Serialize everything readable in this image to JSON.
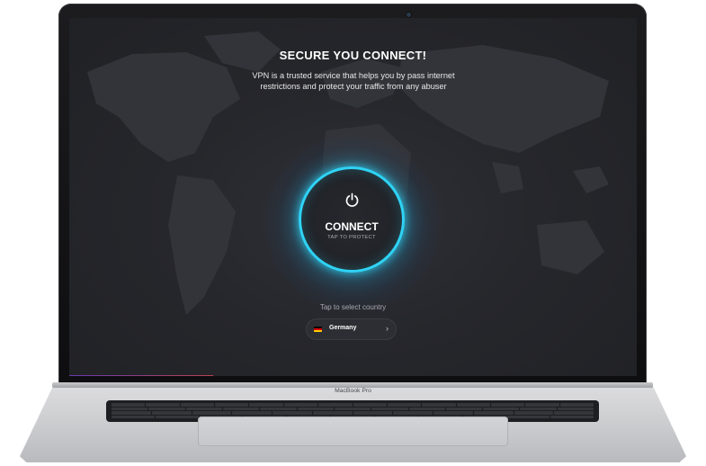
{
  "device": {
    "brand_label": "MacBook Pro"
  },
  "vpn": {
    "title": "SECURE YOU CONNECT!",
    "description": "VPN is a trusted service that helps you by pass internet restrictions and protect your traffic from any abuser",
    "connect_button": {
      "label": "CONNECT",
      "sublabel": "TAP TO PROTECT",
      "icon": "power-icon"
    },
    "country": {
      "hint": "Tap to select country",
      "selected": "Germany",
      "flag_icon": "germany-flag-icon",
      "chevron_icon": "chevron-right-icon"
    }
  },
  "colors": {
    "accent": "#2fd3f5",
    "background": "#26272c",
    "flag_black": "#000000",
    "flag_red": "#dd0000",
    "flag_gold": "#ffce00"
  }
}
